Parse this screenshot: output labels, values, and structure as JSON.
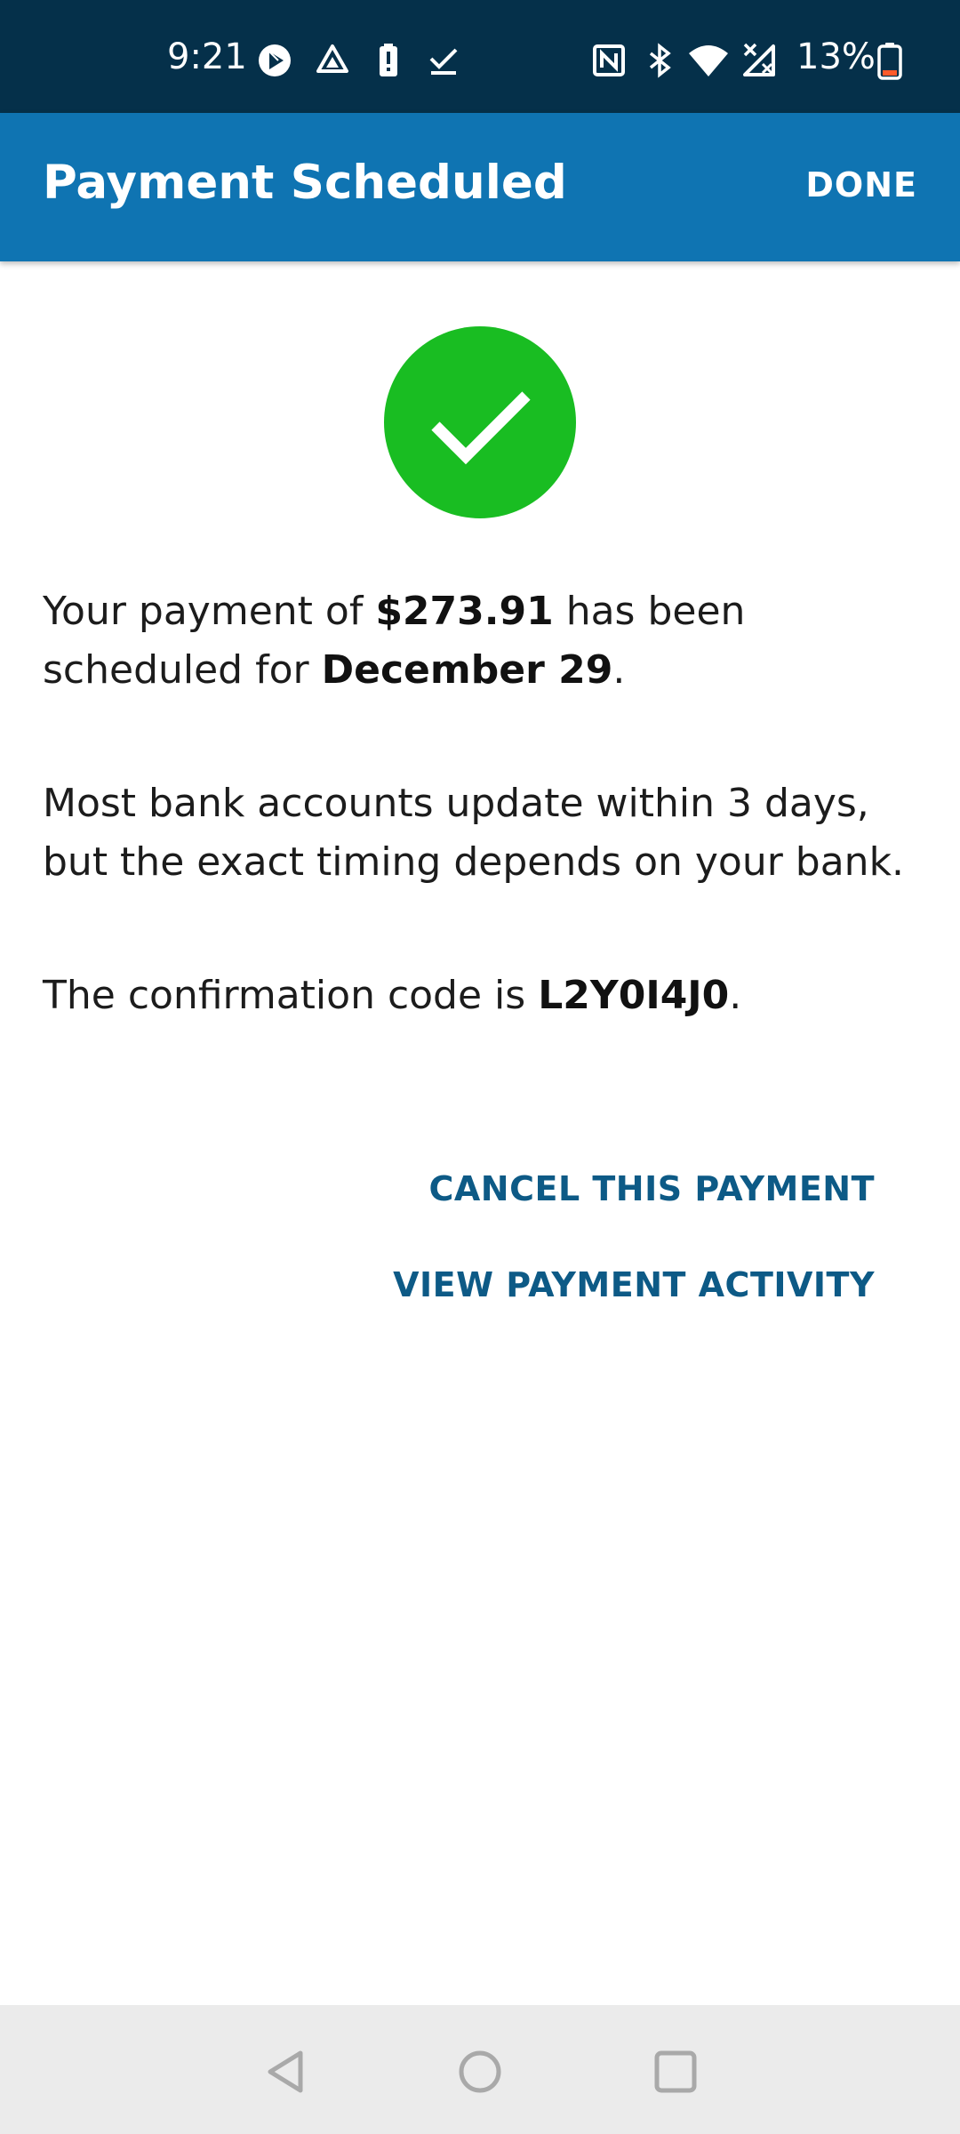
{
  "status_bar": {
    "time": "9:21",
    "battery_percent": "13%",
    "icons": [
      "play-circle-icon",
      "drive-icon",
      "battery-alert-icon",
      "done-check-icon",
      "nfc-icon",
      "bluetooth-icon",
      "wifi-icon",
      "signal-off-icon",
      "battery-icon"
    ]
  },
  "app_bar": {
    "title": "Payment Scheduled",
    "done_label": "DONE",
    "background_color": "#0f74b2"
  },
  "success": {
    "icon": "checkmark-icon",
    "color": "#19bd22"
  },
  "message": {
    "line1_prefix": "Your payment of ",
    "amount": "$273.91",
    "line1_middle": " has been scheduled for ",
    "date": "December 29",
    "line1_suffix": ".",
    "bank_note": "Most bank accounts update within 3 days, but the exact timing depends on your bank.",
    "confirmation_prefix": "The confirmation code is ",
    "confirmation_code": "L2Y0I4J0",
    "confirmation_suffix": "."
  },
  "actions": {
    "cancel_label": "CANCEL THIS PAYMENT",
    "view_activity_label": "VIEW PAYMENT ACTIVITY",
    "link_color": "#0d5a86"
  },
  "nav_bar": {
    "buttons": [
      "back-icon",
      "home-icon",
      "recents-icon"
    ]
  }
}
